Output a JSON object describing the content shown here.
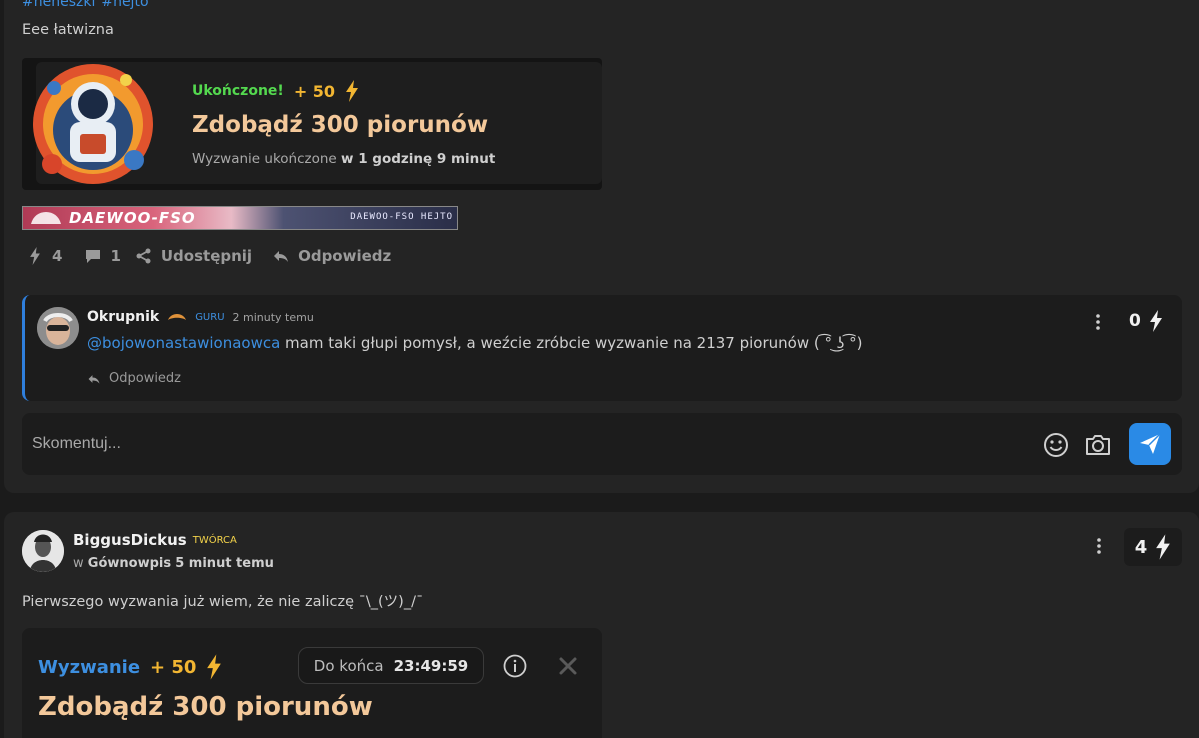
{
  "post1": {
    "tags": [
      "#neneszki",
      "#hejto"
    ],
    "body": "Eee łatwizna",
    "challenge": {
      "status": "Ukończone!",
      "points": "+ 50",
      "title": "Zdobądź 300 piorunów",
      "subtitle_prefix": "Wyzwanie ukończone",
      "subtitle_bold": "w 1 godzinę 9 minut"
    },
    "banner": {
      "brand": "DAEWOO-FSO",
      "brand_small": "DAEWOO-FSO HEJTO"
    },
    "actions": {
      "likes": "4",
      "comments": "1",
      "share": "Udostępnij",
      "reply": "Odpowiedz"
    },
    "comment": {
      "user": "Okrupnik",
      "rank": "GURU",
      "time": "2 minuty temu",
      "mention": "@bojowonastawionaowca",
      "text": " mam taki głupi pomysł, a weźcie zróbcie wyzwanie na 2137 piorunów ( ͡° ͜ʖ ͡°)",
      "reply": "Odpowiedz",
      "score": "0"
    },
    "input": {
      "placeholder": "Skomentuj..."
    }
  },
  "post2": {
    "user": "BiggusDickus",
    "role": "TWÓRCA",
    "in_prefix": "w",
    "community": "Gównowpis",
    "time": "5 minut temu",
    "score": "4",
    "body": "Pierwszego wyzwania już wiem, że nie zaliczę ¯\\_(ツ)_/¯",
    "challenge": {
      "label": "Wyzwanie",
      "points": "+ 50",
      "timer_label": "Do końca",
      "timer_value": "23:49:59",
      "title": "Zdobądź 300 piorunów"
    }
  },
  "colors": {
    "accent": "#2a8ae6",
    "points": "#f2b632",
    "title": "#f3c89a",
    "completed": "#54d94f"
  }
}
